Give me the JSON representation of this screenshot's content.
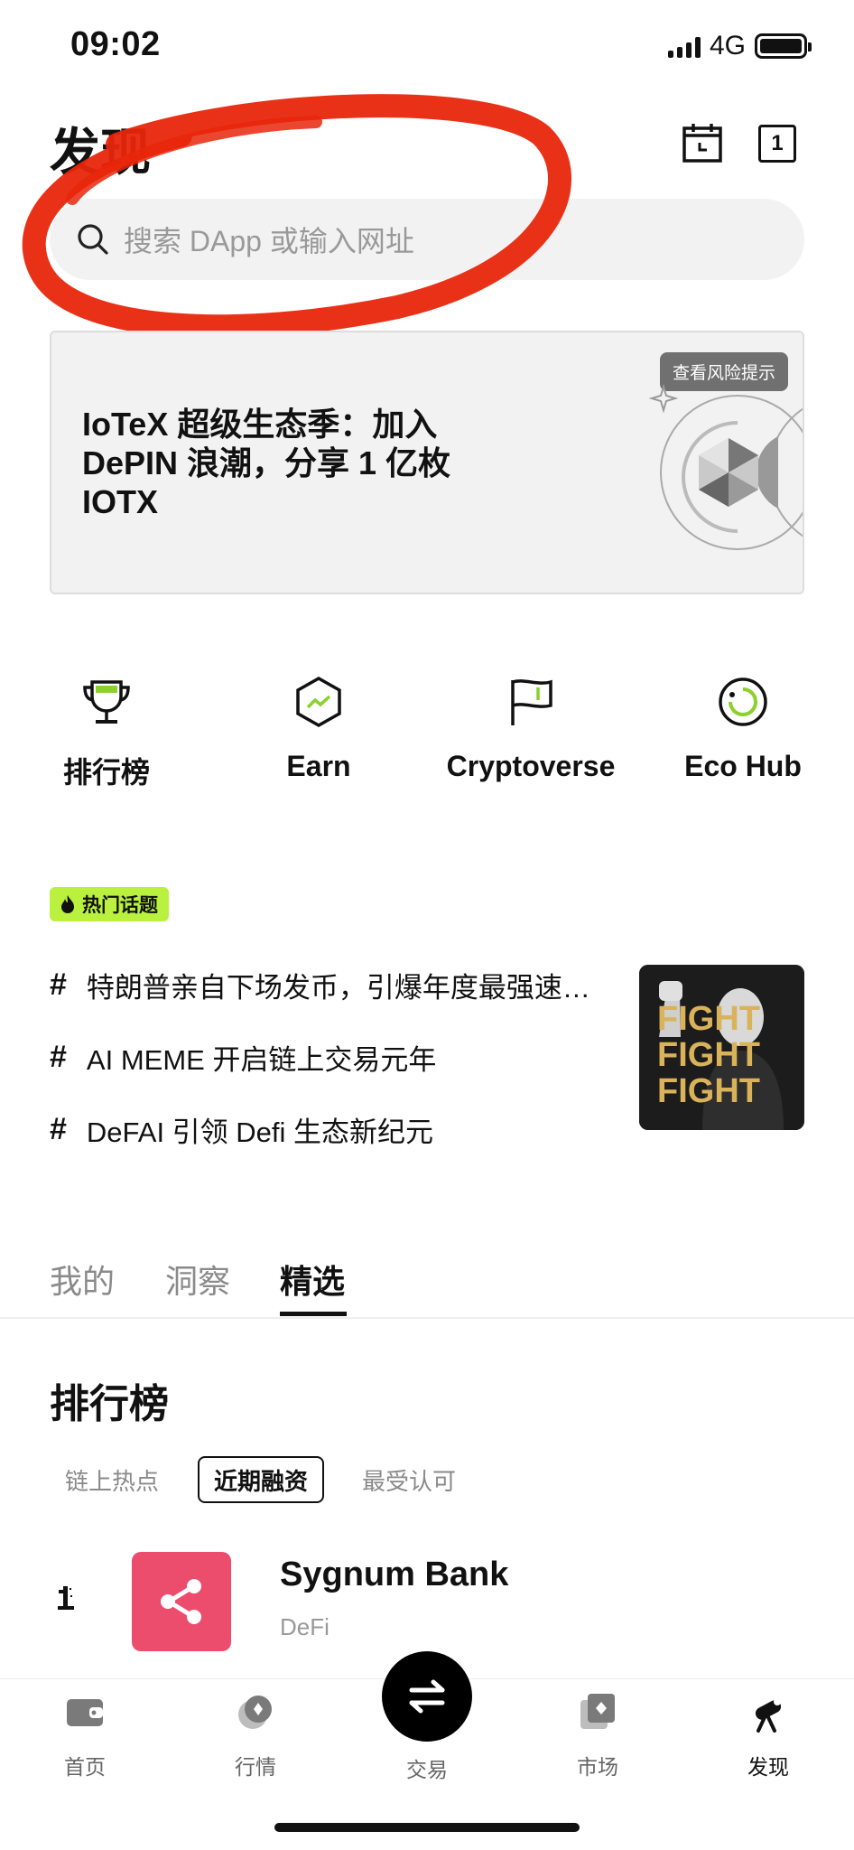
{
  "status_bar": {
    "time": "09:02",
    "network": "4G"
  },
  "header": {
    "title": "发现",
    "tab_count": "1"
  },
  "search": {
    "placeholder": "搜索 DApp 或输入网址"
  },
  "banner": {
    "title": "IoTeX 超级生态季：加入 DePIN 浪潮，分享 1 亿枚 IOTX",
    "risk_tag": "查看风险提示"
  },
  "quick_links": [
    {
      "label": "排行榜",
      "icon": "trophy-icon"
    },
    {
      "label": "Earn",
      "icon": "hexagon-chart-icon"
    },
    {
      "label": "Cryptoverse",
      "icon": "flag-icon"
    },
    {
      "label": "Eco Hub",
      "icon": "ring-icon"
    }
  ],
  "hot_topics": {
    "badge": "热门话题",
    "items": [
      {
        "hash": "#",
        "text": "特朗普亲自下场发币，引爆年度最强速…"
      },
      {
        "hash": "#",
        "text": "AI MEME 开启链上交易元年"
      },
      {
        "hash": "#",
        "text": "DeFAI 引领 Defi 生态新纪元"
      }
    ],
    "image_text": [
      "FIGHT",
      "FIGHT",
      "FIGHT"
    ]
  },
  "tabs": [
    "我的",
    "洞察",
    "精选"
  ],
  "ranking": {
    "title": "排行榜",
    "filters": [
      "链上热点",
      "近期融资",
      "最受认可"
    ],
    "items": [
      {
        "name": "Sygnum Bank",
        "category": "DeFi",
        "logo_color": "#ec4d6d"
      }
    ]
  },
  "bottom_nav": {
    "items": [
      {
        "label": "首页",
        "icon": "wallet-icon"
      },
      {
        "label": "行情",
        "icon": "coins-icon"
      },
      {
        "label": "交易",
        "icon": "swap-icon"
      },
      {
        "label": "市场",
        "icon": "cards-icon"
      },
      {
        "label": "发现",
        "icon": "telescope-icon"
      }
    ]
  },
  "colors": {
    "accent": "#b9f13e",
    "annotation": "#e8260c",
    "logo": "#ec4d6d"
  }
}
